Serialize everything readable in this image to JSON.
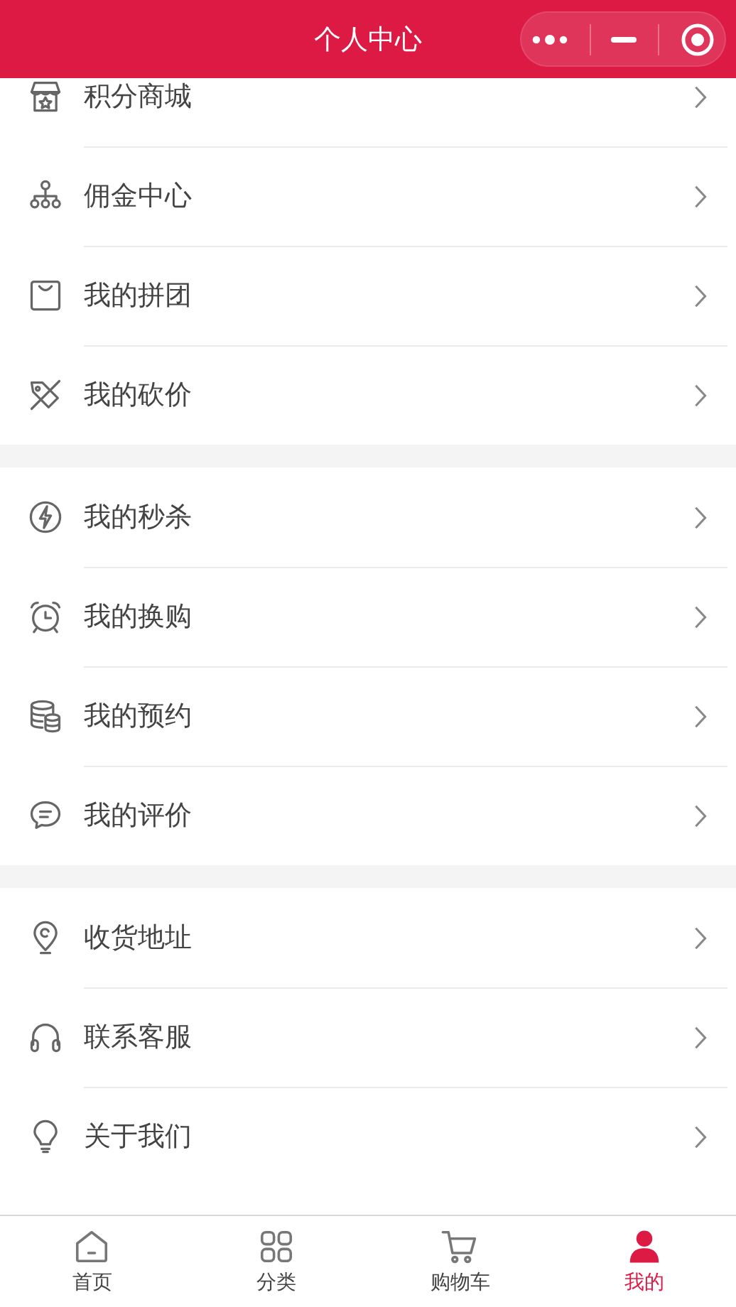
{
  "header": {
    "title": "个人中心"
  },
  "groups": [
    {
      "items": [
        {
          "label": "积分商城"
        },
        {
          "label": "佣金中心"
        },
        {
          "label": "我的拼团"
        },
        {
          "label": "我的砍价"
        }
      ]
    },
    {
      "items": [
        {
          "label": "我的秒杀"
        },
        {
          "label": "我的换购"
        },
        {
          "label": "我的预约"
        },
        {
          "label": "我的评价"
        }
      ]
    },
    {
      "items": [
        {
          "label": "收货地址"
        },
        {
          "label": "联系客服"
        },
        {
          "label": "关于我们"
        }
      ]
    }
  ],
  "tabbar": [
    {
      "label": "首页",
      "selected": false
    },
    {
      "label": "分类",
      "selected": false
    },
    {
      "label": "购物车",
      "selected": false
    },
    {
      "label": "我的",
      "selected": true
    }
  ]
}
